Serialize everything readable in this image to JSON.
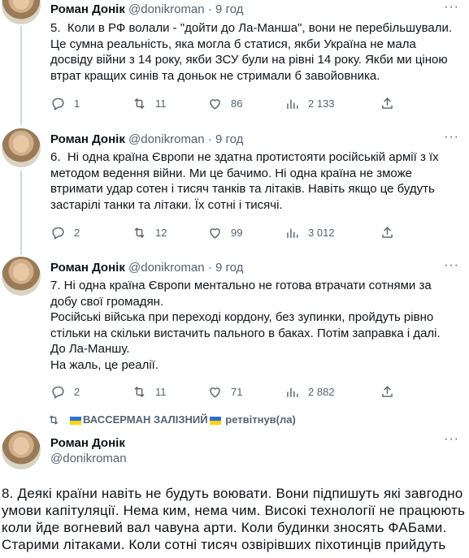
{
  "tweets": [
    {
      "name": "Роман Донік",
      "handle": "@donikroman · 9 год",
      "text": "5.  Коли в РФ волали - \"дойти до Ла-Манша\", вони не перебільшували.\nЦе сумна реальність, яка могла б статися, якби Україна не мала досвіду війни з 14 року, якби ЗСУ були на рівні 14 року. Якби ми ціною втрат кращих синів та доньок не стримали б завойовника.",
      "replies": "1",
      "retweets": "11",
      "likes": "86",
      "views": "2 133"
    },
    {
      "name": "Роман Донік",
      "handle": "@donikroman · 9 год",
      "text": "6.  Ні одна країна Європи не здатна протистояти російській армії з їх методом ведення війни. Ми це бачимо. Ні одна країна не зможе втримати удар сотен і тисяч танків та літаків. Навіть якщо це будуть застарілі танки та літаки. Їх сотні і тисячі.",
      "replies": "2",
      "retweets": "12",
      "likes": "99",
      "views": "3 012"
    },
    {
      "name": "Роман Донік",
      "handle": "@donikroman · 9 год",
      "text": "7. Ні одна країна Європи ментально не готова втрачати сотнями за добу свої громадян.\nРосійські війська при переході кордону, без зупинки, пройдуть рівно стільки на скільки вистачить пального в баках. Потім заправка і далі. До Ла-Маншу.\nНа жаль, це реалії.",
      "replies": "2",
      "retweets": "11",
      "likes": "71",
      "views": "2 882"
    }
  ],
  "retweet_by": {
    "name": "ВАССЕРМАН ЗАЛІЗНИЙ",
    "suffix": "ретвітнув(ла)"
  },
  "main_tweet": {
    "name": "Роман Донік",
    "handle": "@donikroman",
    "text": "8. Деякі країни навіть не будуть воювати. Вони підпишуть які завгодно умови капітуляції. Нема ким, нема чим. Високі технології не працюють коли йде вогневий вал чавуна арти. Коли будинки зносять ФАБами. Старими літаками. Коли сотні тисяч озвірівших піхотинців прийдуть"
  },
  "icons": [
    "reply-icon",
    "retweet-icon",
    "like-icon",
    "views-icon",
    "share-icon",
    "more-icon",
    "flag-ua"
  ],
  "colors": {
    "secondary": "#536471",
    "thread": "#cfd9de",
    "flag_blue": "#2a6fdb",
    "flag_yellow": "#ffd500"
  }
}
